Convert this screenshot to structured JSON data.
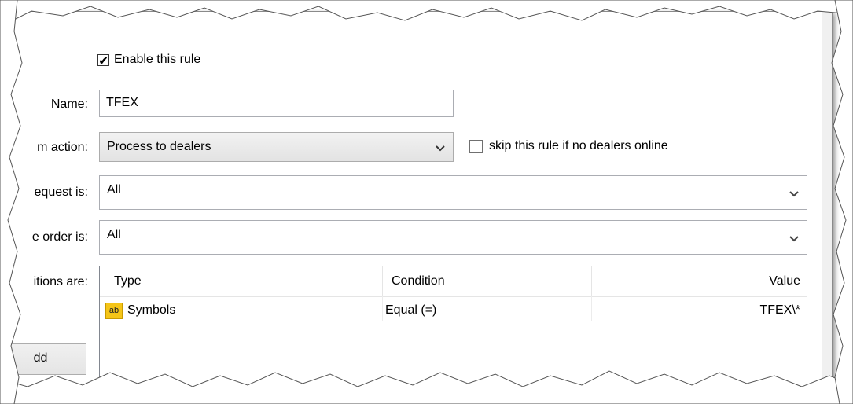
{
  "rule": {
    "enable_label": "Enable this rule",
    "enabled": true,
    "name_label": "Name:",
    "name_value": "TFEX",
    "action_label": "m action:",
    "action_value": "Process to dealers",
    "skip_label": "skip this rule if no dealers online",
    "skip_checked": false,
    "request_label": "equest is:",
    "request_value": "All",
    "order_label": "e order is:",
    "order_value": "All",
    "conditions_label": "itions are:"
  },
  "conditions": {
    "columns": [
      "Type",
      "Condition",
      "Value"
    ],
    "rows": [
      {
        "type": "Symbols",
        "type_icon": "text-field-icon",
        "condition": "Equal (=)",
        "value": "TFEX\\*"
      }
    ]
  },
  "buttons": {
    "add_label": "dd"
  },
  "icons": {
    "checkmark": "✔",
    "type_badge": "ab"
  },
  "colors": {
    "border": "#abadb3",
    "grid_border": "#828790",
    "icon_yellow": "#f5c518"
  }
}
